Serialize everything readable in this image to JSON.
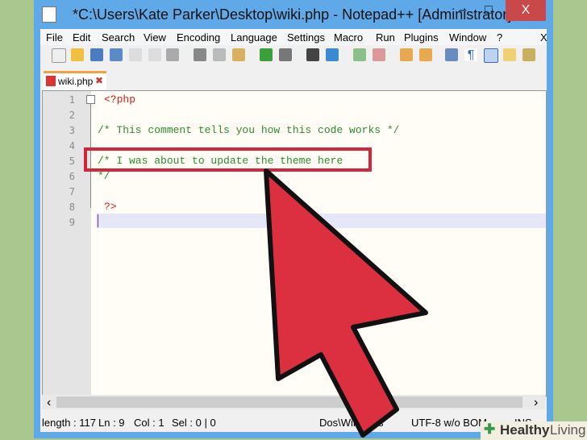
{
  "window": {
    "title": "*C:\\Users\\Kate Parker\\Desktop\\wiki.php - Notepad++ [Administrator]",
    "minimize": "–",
    "maximize": "□",
    "close": "X"
  },
  "menu": [
    "File",
    "Edit",
    "Search",
    "View",
    "Encoding",
    "Language",
    "Settings",
    "Macro",
    "Run",
    "Plugins",
    "Window",
    "?"
  ],
  "menu_close": "X",
  "tab": {
    "label": "wiki.php",
    "close": "✖"
  },
  "editor": {
    "lines": [
      "<?php",
      "",
      "/* This comment tells you how this code works */",
      "",
      "/* I was about to update the theme here",
      "*/",
      "",
      "?>",
      ""
    ],
    "line_numbers": [
      "1",
      "2",
      "3",
      "4",
      "5",
      "6",
      "7",
      "8",
      "9"
    ]
  },
  "status": {
    "length": "length : 117",
    "ln": "Ln : 9",
    "col": "Col : 1",
    "sel": "Sel : 0 | 0",
    "eol": "Dos\\Windows",
    "encoding": "UTF-8 w/o BOM",
    "mode": "INS"
  },
  "scroll": {
    "left": "‹",
    "right": "›"
  },
  "watermark": {
    "brand": "Healthy",
    "brand2": "Living"
  },
  "colors": {
    "highlight": "#d3263a",
    "arrow": "#dc3040"
  }
}
